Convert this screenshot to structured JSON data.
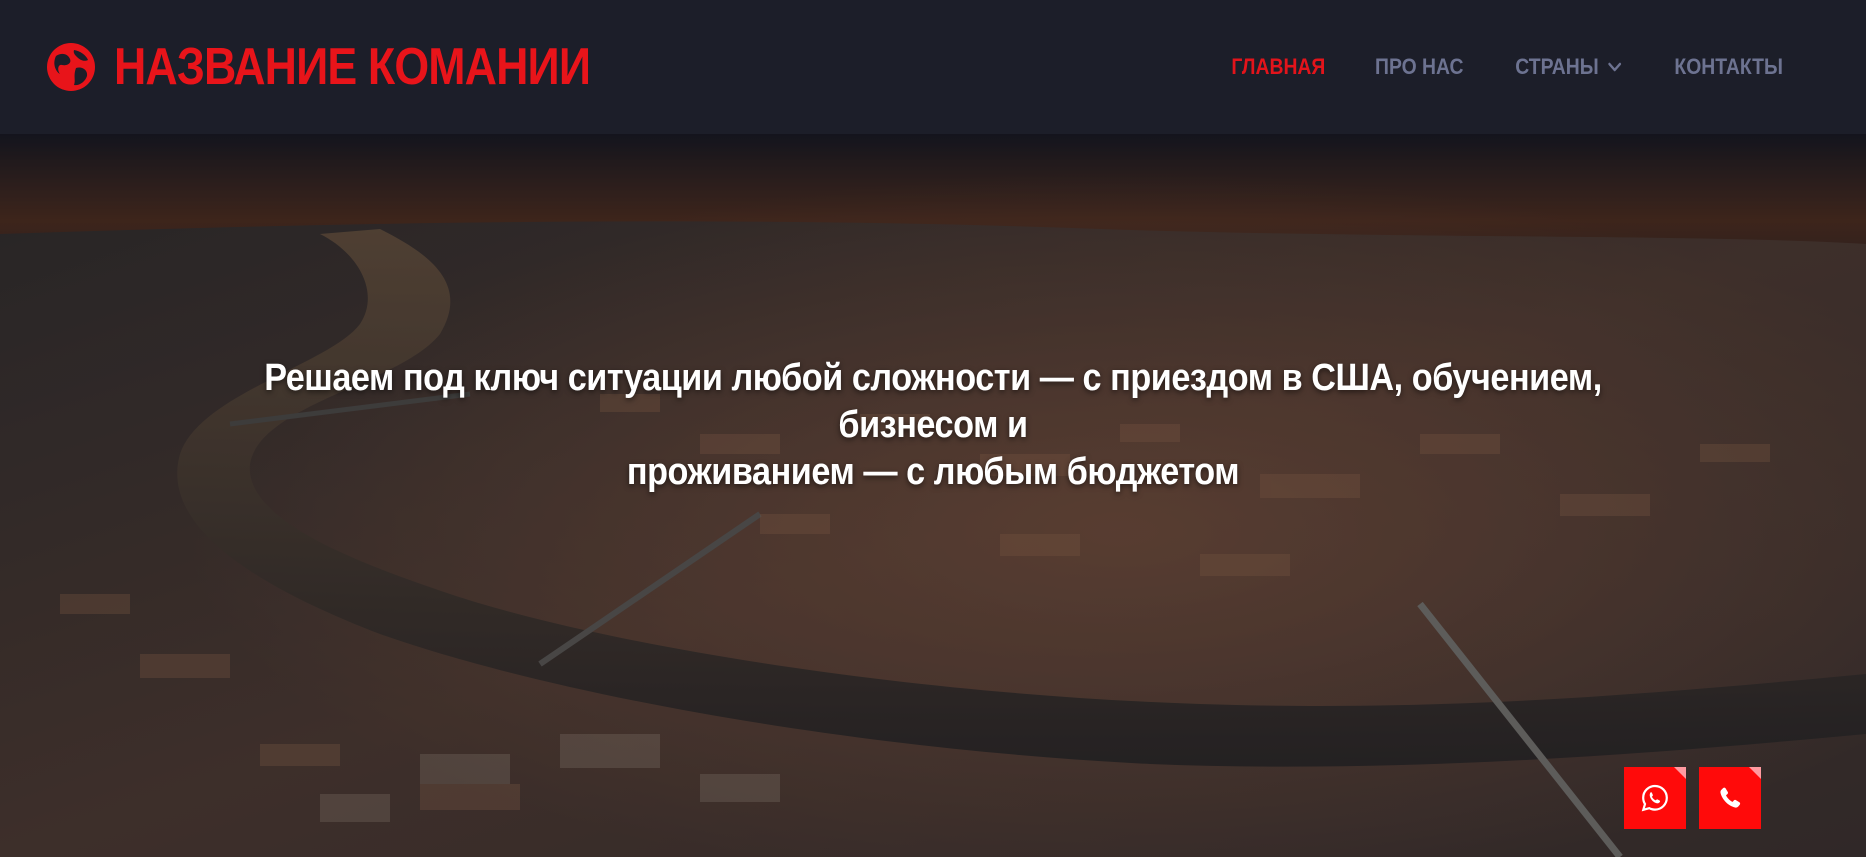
{
  "brand": {
    "name": "НАЗВАНИЕ КОМАНИИ",
    "logo_icon": "globe-icon",
    "color": "#e8141a"
  },
  "nav": {
    "items": [
      {
        "label": "ГЛАВНАЯ",
        "active": true
      },
      {
        "label": "ПРО НАС",
        "active": false
      },
      {
        "label": "СТРАНЫ",
        "active": false,
        "has_dropdown": true
      },
      {
        "label": "КОНТАКТЫ",
        "active": false
      }
    ],
    "active_color": "#e3141b",
    "inactive_color": "#6d7391"
  },
  "hero": {
    "title_line1": "Решаем под ключ ситуации любой сложности — с приездом в США, обучением, бизнесом и",
    "title_line2": "проживанием — с любым бюджетом",
    "background": "aerial-city-river-photo"
  },
  "contact_buttons": [
    {
      "icon": "whatsapp-icon"
    },
    {
      "icon": "phone-icon"
    }
  ]
}
